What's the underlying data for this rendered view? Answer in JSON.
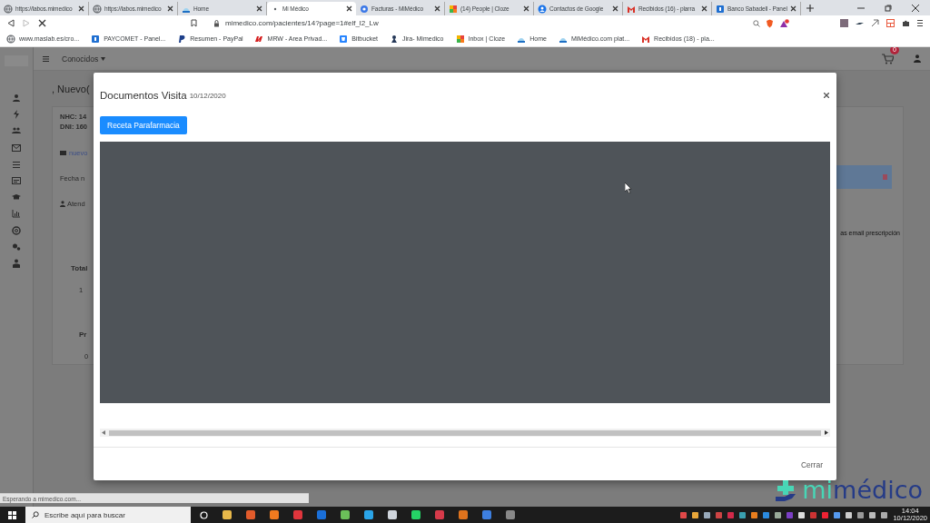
{
  "browser": {
    "tabs": [
      {
        "title": "https://labos.mimedico",
        "kind": "globe",
        "selected": false
      },
      {
        "title": "https://labos.mimedico",
        "kind": "globe",
        "selected": false
      },
      {
        "title": "Home",
        "kind": "cloud",
        "selected": false
      },
      {
        "title": "Mi Médico",
        "kind": "loading",
        "selected": true
      },
      {
        "title": "Facturas - MiMédico",
        "kind": "chrome",
        "selected": false
      },
      {
        "title": "(14) People | Cloze",
        "kind": "cloze",
        "selected": false
      },
      {
        "title": "Contactos de Google",
        "kind": "contacts",
        "selected": false
      },
      {
        "title": "Recibidos (16) - plarra",
        "kind": "gmail",
        "selected": false
      },
      {
        "title": "Banco Sabadell - Panel",
        "kind": "bank",
        "selected": false
      }
    ],
    "url": "mimedico.com/pacientes/14?page=1#elf_l2_Lw",
    "bookmarks": [
      {
        "title": "www.maslab.es/cro...",
        "kind": "globe"
      },
      {
        "title": "PAYCOMET - Panel...",
        "kind": "bank"
      },
      {
        "title": "Resumen - PayPal",
        "kind": "paypal"
      },
      {
        "title": "MRW - Area Privad...",
        "kind": "mrw"
      },
      {
        "title": "Bitbucket",
        "kind": "bitbucket"
      },
      {
        "title": "Jira- Mimedico",
        "kind": "jira"
      },
      {
        "title": "Inbox | Cloze",
        "kind": "cloze"
      },
      {
        "title": "Home",
        "kind": "cloud"
      },
      {
        "title": "MiMédico.com plat...",
        "kind": "cloud"
      },
      {
        "title": "Recibidos (18) - pla...",
        "kind": "gmail"
      }
    ],
    "status": "Esperando a mimedico.com..."
  },
  "page": {
    "nav": {
      "menu": "Conocidos"
    },
    "cart_count": "0",
    "heading": ", Nuevo(",
    "card": {
      "nhc": "NHC: 14",
      "dni": "DNI: 160",
      "link": "nuevo",
      "date_label": "Fecha n",
      "attended": "Atend",
      "total_header": "Total",
      "total_value": "1",
      "pr_header": "Pr",
      "pr_value": "0"
    },
    "side_note": "as email prescripción",
    "logo": {
      "accent": "mi",
      "rest": "médico"
    }
  },
  "modal": {
    "title": "Documentos Visita",
    "date": "10/12/2020",
    "button": "Receta Parafarmacia",
    "close_button": "Cerrar"
  },
  "taskbar": {
    "search_placeholder": "Escribe aquí para buscar",
    "time": "14:04",
    "date": "10/12/2020"
  }
}
